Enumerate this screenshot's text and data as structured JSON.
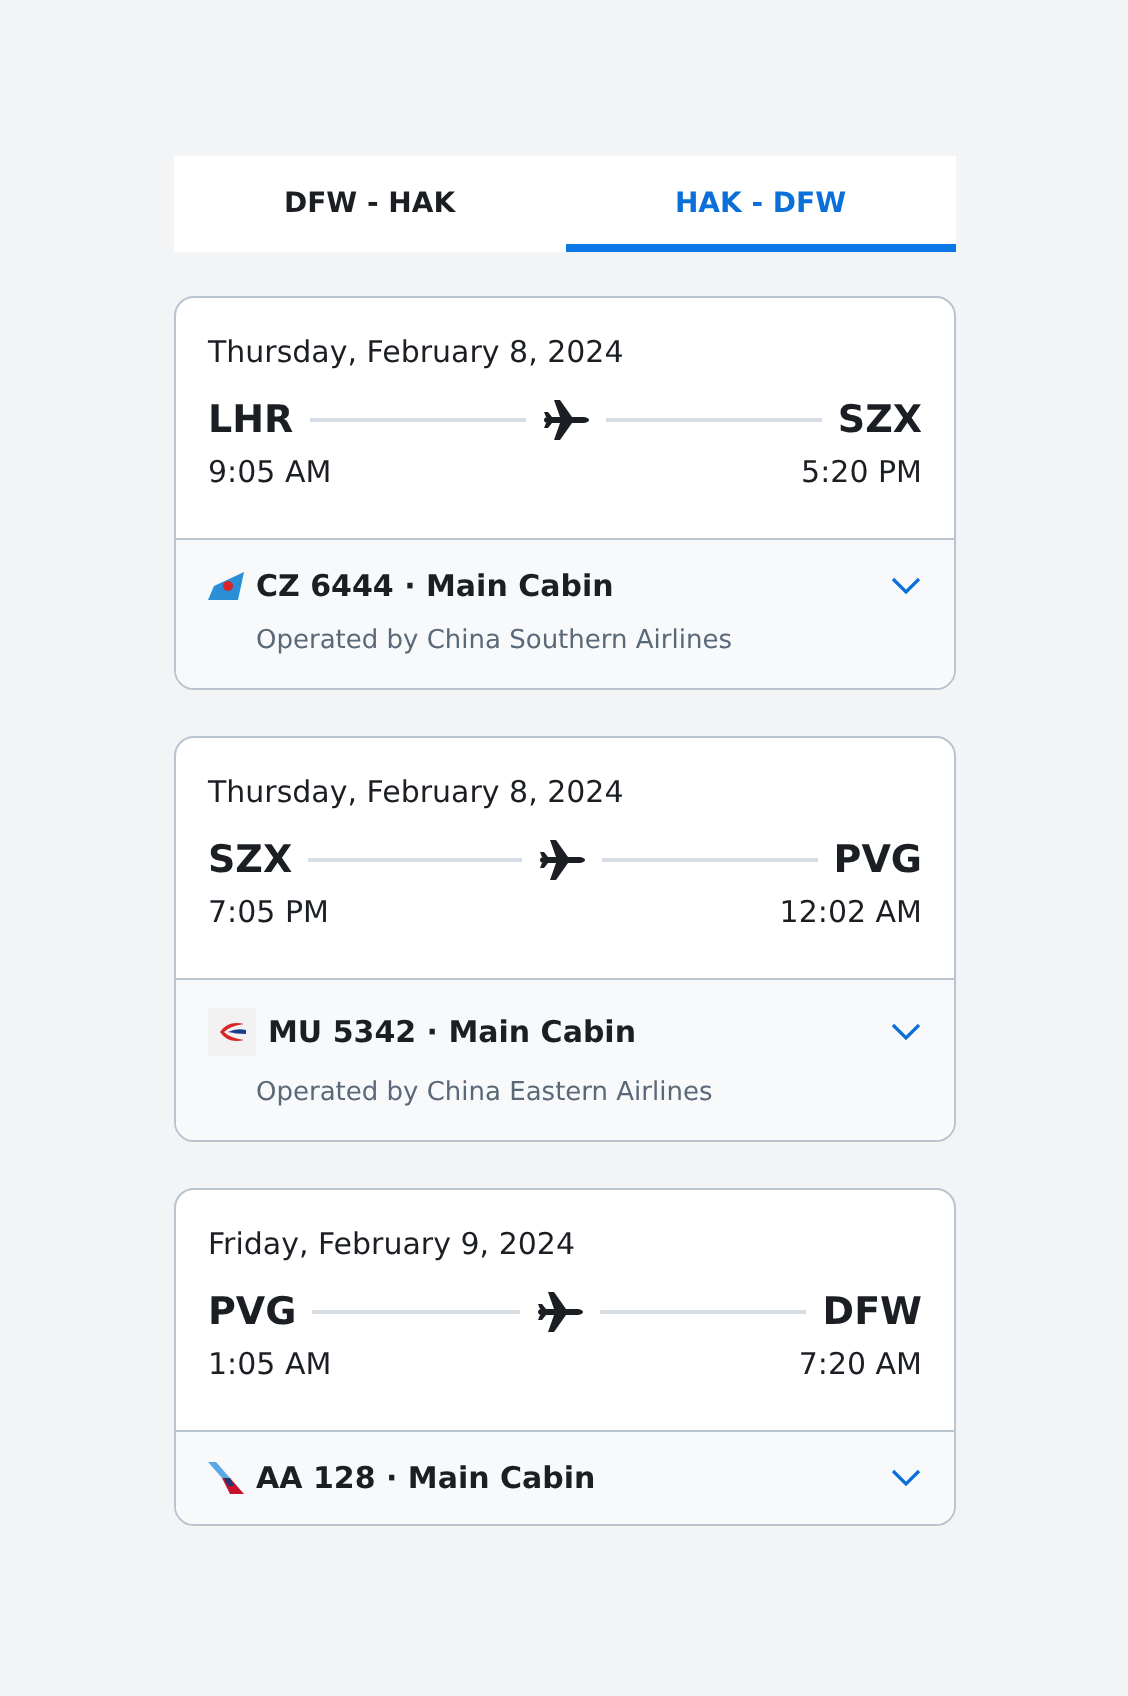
{
  "tabs": [
    {
      "label": "DFW - HAK",
      "selected": false
    },
    {
      "label": "HAK - DFW",
      "selected": true
    }
  ],
  "segments": [
    {
      "date": "Thursday, February 8, 2024",
      "origin": "LHR",
      "destination": "SZX",
      "departure": "9:05 AM",
      "arrival": "5:20 PM",
      "kind": "tail",
      "flight": "CZ 6444 · Main Cabin",
      "operated_by": "Operated by China Southern Airlines",
      "expanded": false
    },
    {
      "date": "Thursday, February 8, 2024",
      "origin": "SZX",
      "destination": "PVG",
      "departure": "7:05 PM",
      "arrival": "12:02 AM",
      "kind": "swirl",
      "flight": "MU 5342 · Main Cabin",
      "operated_by": "Operated by China Eastern Airlines",
      "expanded": false
    },
    {
      "date": "Friday, February 9, 2024",
      "origin": "PVG",
      "destination": "DFW",
      "departure": "1:05 AM",
      "arrival": "7:20 AM",
      "kind": "stripe",
      "flight": "AA 128 · Main Cabin",
      "expanded": false
    }
  ]
}
